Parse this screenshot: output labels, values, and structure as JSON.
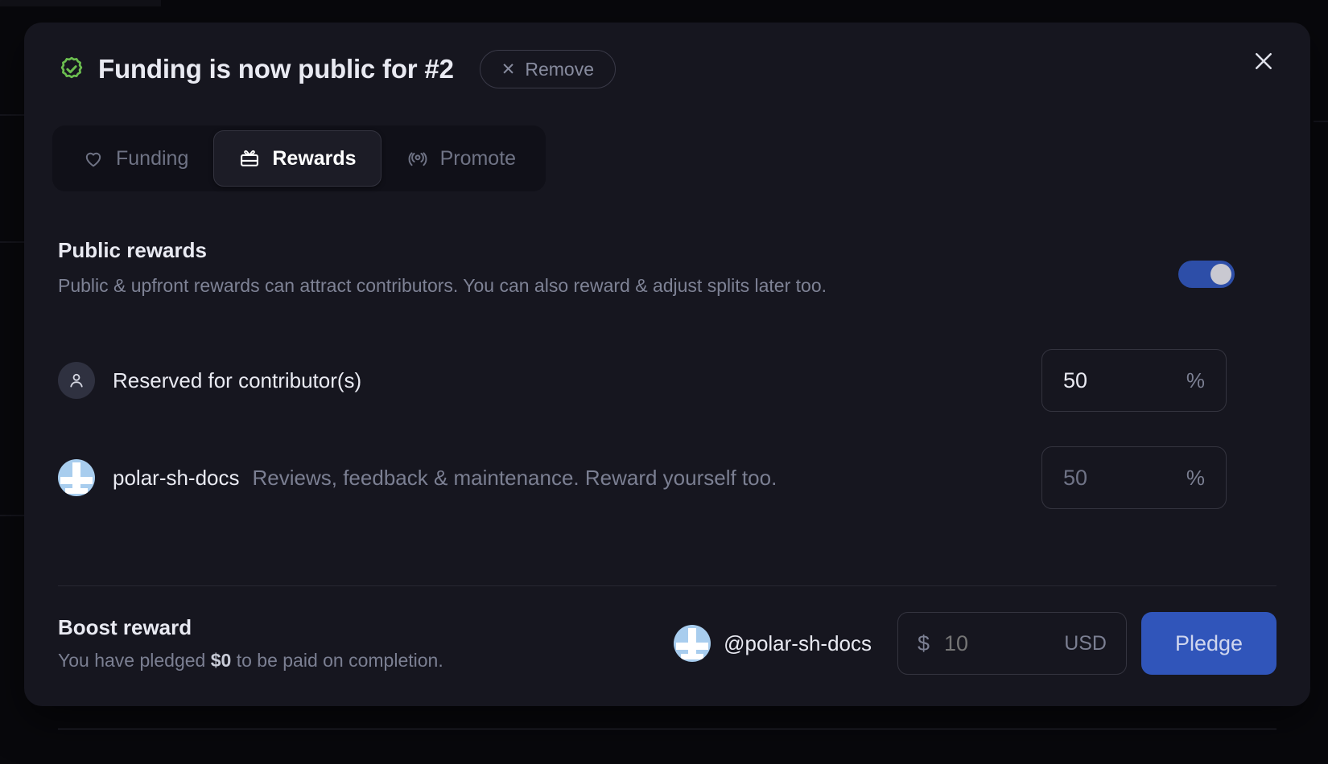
{
  "header": {
    "verified_icon": "verified-check-icon",
    "title": "Funding is now public for #2",
    "remove_label": "Remove",
    "remove_icon": "x-icon",
    "close_icon": "close-icon"
  },
  "tabs": [
    {
      "label": "Funding",
      "icon": "heart-icon",
      "active": false
    },
    {
      "label": "Rewards",
      "icon": "gift-icon",
      "active": true
    },
    {
      "label": "Promote",
      "icon": "broadcast-icon",
      "active": false
    }
  ],
  "public_rewards": {
    "title": "Public rewards",
    "description": "Public & upfront rewards can attract contributors. You can also reward & adjust splits later too.",
    "toggle_on": true,
    "toggle_color": "#2d4ea8"
  },
  "splits": [
    {
      "avatar": "person-icon",
      "label": "Reserved for contributor(s)",
      "sub": "",
      "value": "50",
      "suffix": "%"
    },
    {
      "avatar": "polar-sh-docs-avatar",
      "label": "polar-sh-docs",
      "sub": "Reviews, feedback & maintenance. Reward yourself too.",
      "value": "50",
      "suffix": "%"
    }
  ],
  "boost": {
    "title": "Boost reward",
    "sub_prefix": "You have pledged ",
    "sub_amount": "$0",
    "sub_suffix": " to be paid on completion.",
    "handle": "@polar-sh-docs",
    "handle_avatar": "polar-sh-docs-avatar",
    "amount_symbol": "$",
    "amount_value": "10",
    "amount_placeholder": "10",
    "currency": "USD",
    "pledge_label": "Pledge",
    "pledge_color": "#3055ba"
  }
}
